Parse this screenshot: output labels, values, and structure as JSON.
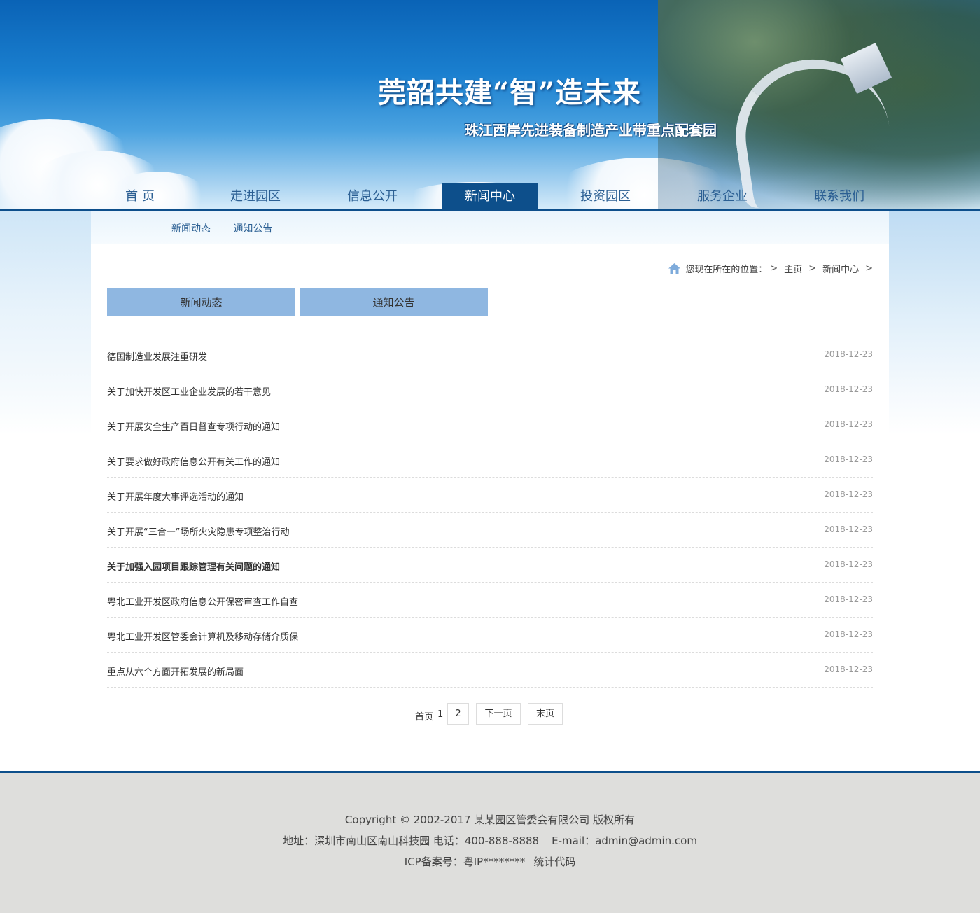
{
  "banner": {
    "title": "莞韶共建“智”造未来",
    "subtitle": "珠江西岸先进装备制造产业带重点配套园"
  },
  "nav": {
    "items": [
      {
        "label": "首  页"
      },
      {
        "label": "走进园区"
      },
      {
        "label": "信息公开"
      },
      {
        "label": "新闻中心",
        "active": true
      },
      {
        "label": "投资园区"
      },
      {
        "label": "服务企业"
      },
      {
        "label": "联系我们"
      }
    ]
  },
  "subnav": {
    "items": [
      "新闻动态",
      "通知公告"
    ]
  },
  "breadcrumb": {
    "prefix": "您现在所在的位置：",
    "sep": ">",
    "home": "主页",
    "current": "新闻中心"
  },
  "tabs": [
    "新闻动态",
    "通知公告"
  ],
  "news": [
    {
      "title": "德国制造业发展注重研发",
      "date": "2018-12-23"
    },
    {
      "title": "关于加快开发区工业企业发展的若干意见",
      "date": "2018-12-23"
    },
    {
      "title": "关于开展安全生产百日督查专项行动的通知",
      "date": "2018-12-23"
    },
    {
      "title": "关于要求做好政府信息公开有关工作的通知",
      "date": "2018-12-23"
    },
    {
      "title": "关于开展年度大事评选活动的通知",
      "date": "2018-12-23"
    },
    {
      "title": "关于开展“三合一”场所火灾隐患专项整治行动",
      "date": "2018-12-23"
    },
    {
      "title": "关于加强入园项目跟踪管理有关问题的通知",
      "date": "2018-12-23"
    },
    {
      "title": "粤北工业开发区政府信息公开保密审查工作自查",
      "date": "2018-12-23"
    },
    {
      "title": "粤北工业开发区管委会计算机及移动存储介质保",
      "date": "2018-12-23"
    },
    {
      "title": "重点从六个方面开拓发展的新局面",
      "date": "2018-12-23"
    }
  ],
  "pagination": {
    "first": "首页",
    "current": "1",
    "page2": "2",
    "next": "下一页",
    "last": "末页"
  },
  "footer": {
    "copyright": "Copyright © 2002-2017 某某园区管委会有限公司 版权所有",
    "address": "地址：深圳市南山区南山科技园 电话：400-888-8888",
    "email": "E-mail：admin@admin.com",
    "icp": "ICP备案号：粤IP********",
    "stats": "统计代码"
  },
  "colors": {
    "nav_active": "#0d4f8b",
    "tab_bg": "#8fb7e1",
    "footer_bg": "#dededc"
  }
}
